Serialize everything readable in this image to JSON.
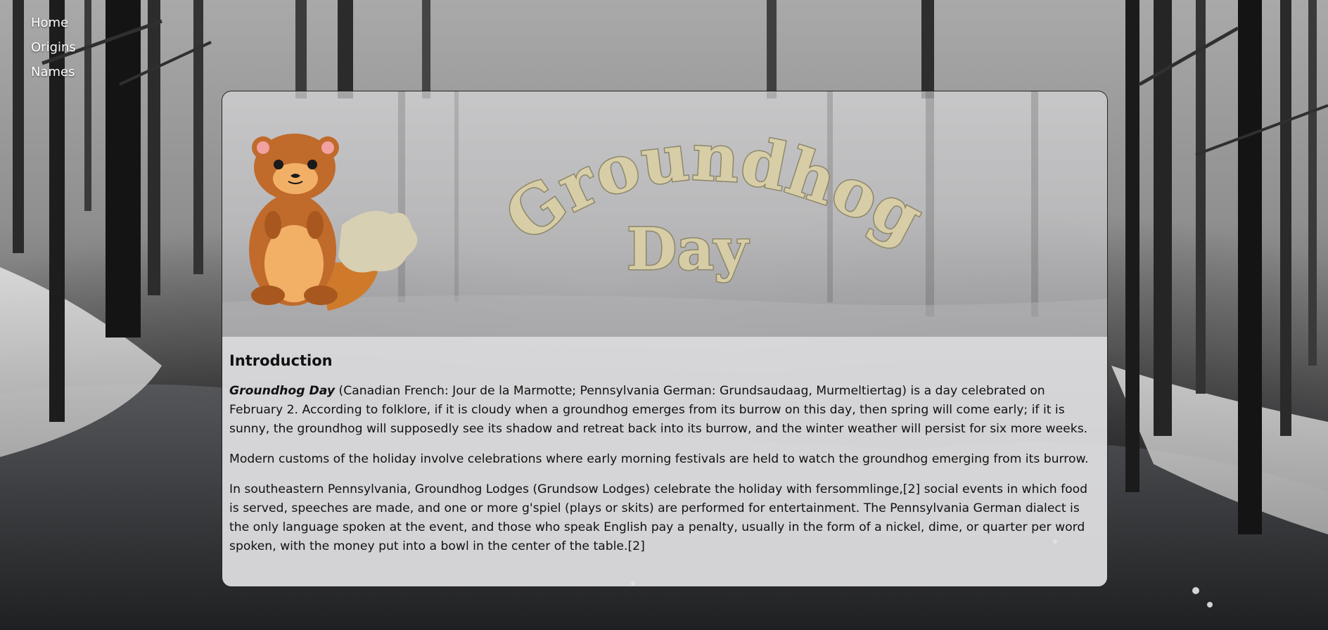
{
  "nav": {
    "items": [
      {
        "label": "Home"
      },
      {
        "label": "Origins"
      },
      {
        "label": "Names"
      }
    ]
  },
  "banner": {
    "title_line1": "Groundhog",
    "title_line2": "Day"
  },
  "intro": {
    "heading": "Introduction",
    "p1_lead": "Groundhog Day",
    "p1_rest": " (Canadian French: Jour de la Marmotte; Pennsylvania German: Grundsaudaag, Murmeltiertag) is a day celebrated on February 2. According to folklore, if it is cloudy when a groundhog emerges from its burrow on this day, then spring will come early; if it is sunny, the groundhog will supposedly see its shadow and retreat back into its burrow, and the winter weather will persist for six more weeks.",
    "p2": "Modern customs of the holiday involve celebrations where early morning festivals are held to watch the groundhog emerging from its burrow.",
    "p3": "In southeastern Pennsylvania, Groundhog Lodges (Grundsow Lodges) celebrate the holiday with fersommlinge,[2] social events in which food is served, speeches are made, and one or more g'spiel (plays or skits) are performed for entertainment. The Pennsylvania German dialect is the only language spoken at the event, and those who speak English pay a penalty, usually in the form of a nickel, dime, or quarter per word spoken, with the money put into a bowl in the center of the table.[2]"
  },
  "colors": {
    "title_fill": "#d9cfa6",
    "title_stroke": "#8b8466",
    "groundhog_body": "#c06a2b",
    "groundhog_belly": "#f2b067",
    "tail": "#cf7a2a"
  }
}
